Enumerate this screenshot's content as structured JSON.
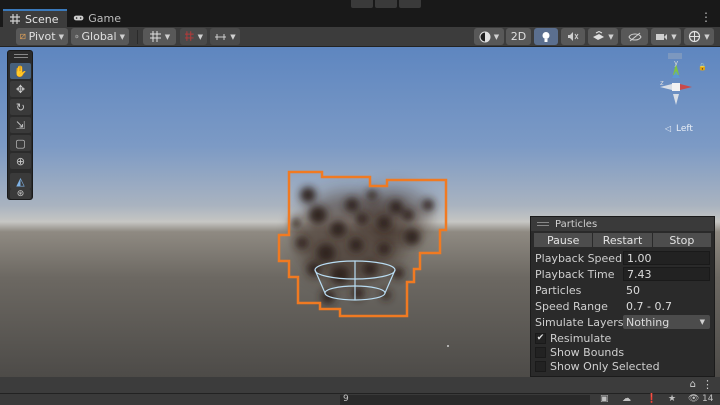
{
  "tabs": [
    {
      "label": "Scene",
      "icon": "scene-grid-icon",
      "active": true
    },
    {
      "label": "Game",
      "icon": "gamepad-icon",
      "active": false
    }
  ],
  "toolbar": {
    "pivot_label": "Pivot",
    "global_label": "Global",
    "mode_2d_label": "2D"
  },
  "scene": {
    "gizmo_label": "Left"
  },
  "particles": {
    "title": "Particles",
    "buttons": {
      "pause": "Pause",
      "restart": "Restart",
      "stop": "Stop"
    },
    "playback_speed": {
      "label": "Playback Speed",
      "value": "1.00"
    },
    "playback_time": {
      "label": "Playback Time",
      "value": "7.43"
    },
    "particles": {
      "label": "Particles",
      "value": "50"
    },
    "speed_range": {
      "label": "Speed Range",
      "value": "0.7 - 0.7"
    },
    "simulate_layers": {
      "label": "Simulate Layers",
      "value": "Nothing"
    },
    "resimulate": {
      "label": "Resimulate",
      "checked": true
    },
    "show_bounds": {
      "label": "Show Bounds",
      "checked": false
    },
    "show_only_selected": {
      "label": "Show Only Selected",
      "checked": false
    }
  },
  "status": {
    "field_value": "9",
    "count": "14"
  },
  "colors": {
    "selection_outline": "#f07a22",
    "accent": "#3a79bb"
  }
}
